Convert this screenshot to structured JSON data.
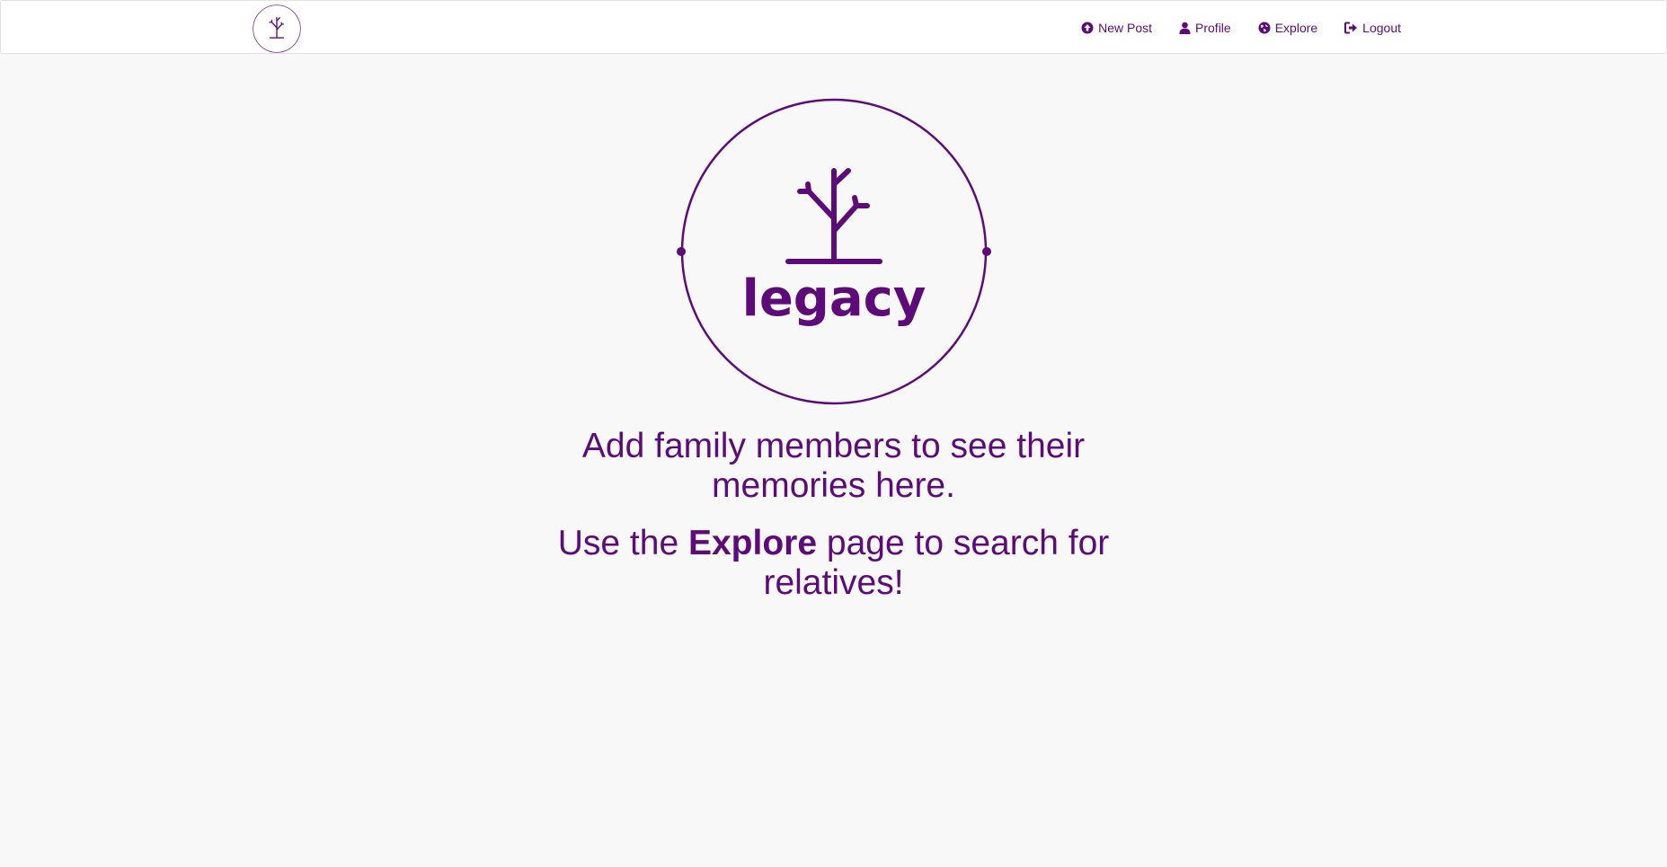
{
  "brand": {
    "name": "legacy",
    "color": "#5e0b7a"
  },
  "nav": {
    "items": [
      {
        "label": "New Post",
        "icon": "arrow-circle-up-icon"
      },
      {
        "label": "Profile",
        "icon": "user-icon"
      },
      {
        "label": "Explore",
        "icon": "globe-icon"
      },
      {
        "label": "Logout",
        "icon": "sign-out-icon"
      }
    ]
  },
  "main": {
    "message_line1": "Add family members to see their memories here.",
    "message_line2_prefix": "Use the ",
    "message_line2_emphasis": "Explore",
    "message_line2_suffix": " page to search for relatives!"
  }
}
